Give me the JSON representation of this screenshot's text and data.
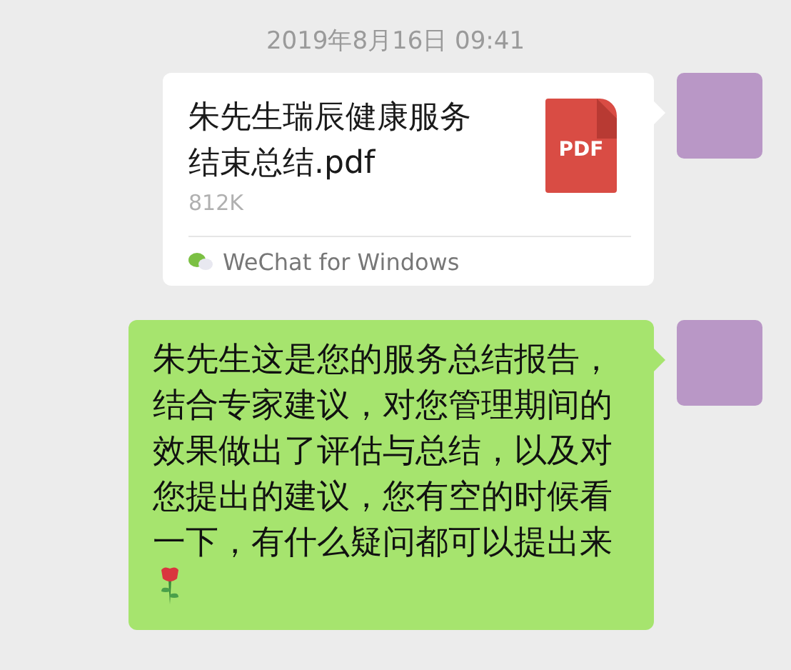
{
  "timestamp": "2019年8月16日 09:41",
  "messages": [
    {
      "kind": "file",
      "file_name": "朱先生瑞辰健康服务结束总结.pdf",
      "file_size": "812K",
      "file_icon_label": "PDF",
      "source": "WeChat for Windows"
    },
    {
      "kind": "text",
      "text": "朱先生这是您的服务总结报告，结合专家建议，对您管理期间的效果做出了评估与总结，以及对您提出的建议，您有空的时候看一下，有什么疑问都可以提出来"
    }
  ]
}
